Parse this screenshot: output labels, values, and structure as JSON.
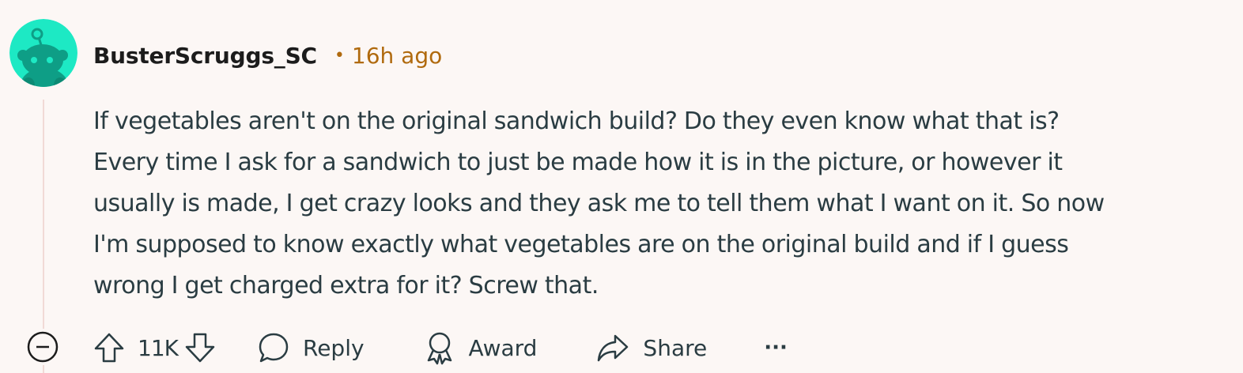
{
  "comment": {
    "author": "BusterScruggs_SC",
    "separator": "•",
    "time": "16h ago",
    "body_lines": [
      "If vegetables aren't on the original sandwich build? Do they even know what that is?",
      "Every time I ask for a sandwich to just be made how it is in the picture, or however it",
      "usually is made, I get crazy looks and they ask me to tell them what I want on it. So now",
      "I'm supposed to know exactly what vegetables are on the original build and if I guess",
      "wrong I get charged extra for it? Screw that."
    ],
    "score": "11K"
  },
  "actions": {
    "reply": "Reply",
    "award": "Award",
    "share": "Share",
    "more": "···"
  },
  "icons": {
    "avatar": "snoo-avatar",
    "collapse": "minus-circle-icon",
    "upvote": "arrow-up-icon",
    "downvote": "arrow-down-icon",
    "reply": "speech-bubble-icon",
    "award": "award-ribbon-icon",
    "share": "share-arrow-icon",
    "more": "ellipsis-icon"
  },
  "colors": {
    "background": "#fcf7f5",
    "avatar_bg": "#1de9c4",
    "avatar_figure": "#0e9e86",
    "timestamp": "#b06a0e",
    "text": "#2a3c42",
    "thread_line": "#f1dad6"
  }
}
